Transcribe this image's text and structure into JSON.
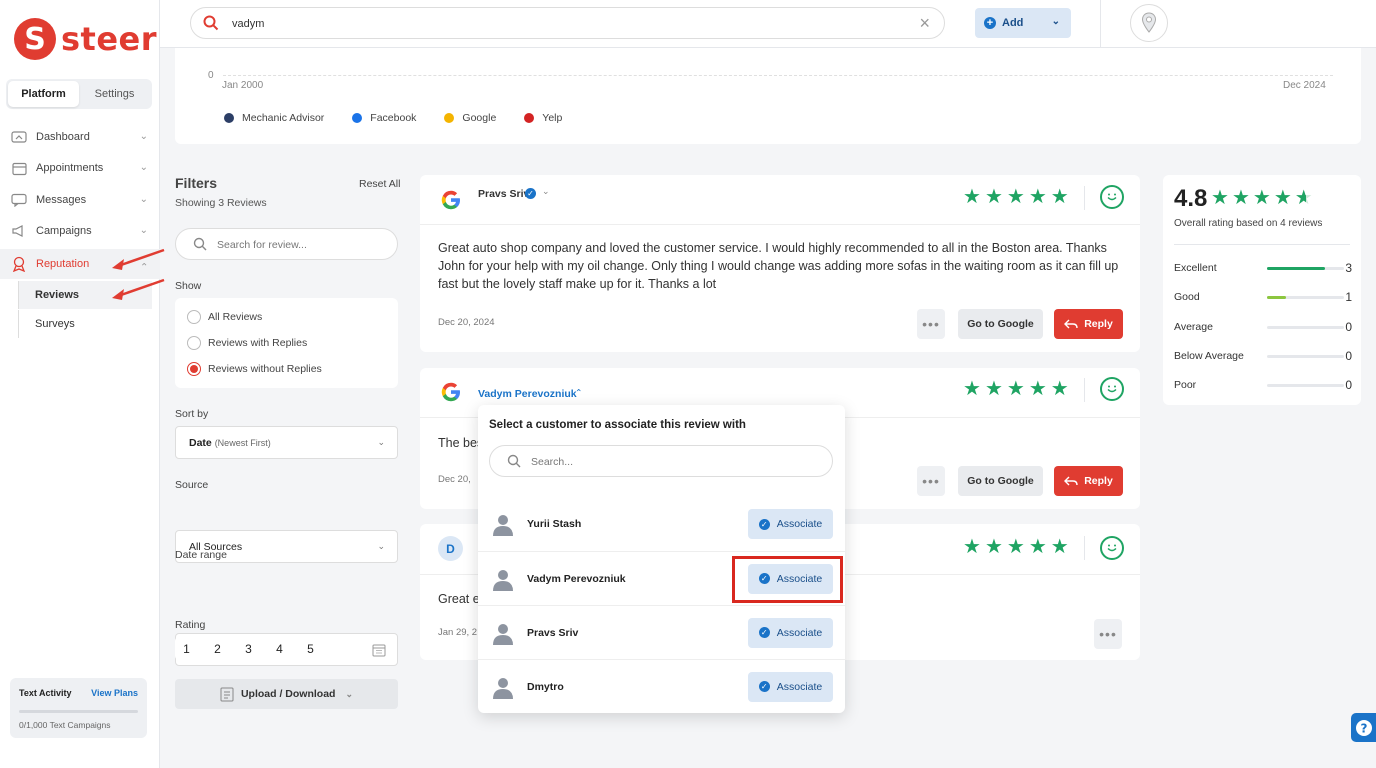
{
  "brand": {
    "name": "steer",
    "mark": "S",
    "color": "#e03c31"
  },
  "sidebar": {
    "tabs": [
      {
        "label": "Platform",
        "active": true
      },
      {
        "label": "Settings",
        "active": false
      }
    ],
    "items": [
      {
        "label": "Dashboard",
        "icon": "dashboard-icon"
      },
      {
        "label": "Appointments",
        "icon": "calendar-icon"
      },
      {
        "label": "Messages",
        "icon": "messages-icon"
      },
      {
        "label": "Campaigns",
        "icon": "megaphone-icon"
      },
      {
        "label": "Reputation",
        "icon": "reputation-icon",
        "active": true
      }
    ],
    "subitems": [
      {
        "label": "Reviews",
        "active": true
      },
      {
        "label": "Surveys"
      }
    ],
    "text_activity": {
      "title": "Text Activity",
      "link": "View Plans",
      "usage": "0/1,000 Text Campaigns"
    }
  },
  "topbar": {
    "search_value": "vadym",
    "add_label": "Add"
  },
  "chart": {
    "y_tick": "0",
    "x_start": "Jan 2000",
    "x_end": "Dec 2024",
    "legend": [
      {
        "name": "Mechanic Advisor",
        "color": "#2c3e66"
      },
      {
        "name": "Facebook",
        "color": "#1a73e8"
      },
      {
        "name": "Google",
        "color": "#f4b400"
      },
      {
        "name": "Yelp",
        "color": "#d32323"
      }
    ]
  },
  "filters": {
    "title": "Filters",
    "reset": "Reset All",
    "showing": "Showing 3 Reviews",
    "search_placeholder": "Search for review...",
    "show_label": "Show",
    "show_options": [
      "All Reviews",
      "Reviews with Replies",
      "Reviews without Replies"
    ],
    "show_selected": 2,
    "sort_label": "Sort by",
    "sort_value": "Date",
    "sort_hint": "(Newest First)",
    "source_label": "Source",
    "source_value": "All Sources",
    "date_label": "Date range",
    "rating_label": "Rating",
    "ratings": [
      "1",
      "2",
      "3",
      "4",
      "5"
    ],
    "upload_label": "Upload / Download"
  },
  "reviews": [
    {
      "reviewer": "Pravs Sriv",
      "verified": true,
      "rating": 5,
      "text": "Great auto shop company and loved the customer service. I would highly recommended to all in the Boston area. Thanks John for your help with my oil change. Only thing I would change was adding more sofas in the waiting room as it can fill up fast but the lovely staff make up for it. Thanks a lot",
      "date": "Dec 20, 2024",
      "goto": "Go to Google",
      "reply": "Reply"
    },
    {
      "reviewer": "Vadym Perevozniuk",
      "rating": 5,
      "text": "The bes",
      "date": "Dec 20,",
      "goto": "Go to Google",
      "reply": "Reply"
    },
    {
      "avatar_letter": "D",
      "rating": 5,
      "text": "Great ex",
      "date": "Jan 29, 2"
    }
  ],
  "summary": {
    "score": "4.8",
    "stars": 4.8,
    "caption": "Overall rating based on 4 reviews",
    "rows": [
      {
        "label": "Excellent",
        "count": "3",
        "fraction": 0.75,
        "color": "#1fa463"
      },
      {
        "label": "Good",
        "count": "1",
        "fraction": 0.25,
        "color": "#8cc63f"
      },
      {
        "label": "Average",
        "count": "0",
        "fraction": 0
      },
      {
        "label": "Below Average",
        "count": "0",
        "fraction": 0
      },
      {
        "label": "Poor",
        "count": "0",
        "fraction": 0
      }
    ]
  },
  "associate_popup": {
    "title": "Select a customer to associate this review with",
    "search_placeholder": "Search...",
    "button_label": "Associate",
    "customers": [
      "Yurii Stash",
      "Vadym Perevozniuk",
      "Pravs Sriv",
      "Dmytro"
    ],
    "highlighted_index": 1
  }
}
